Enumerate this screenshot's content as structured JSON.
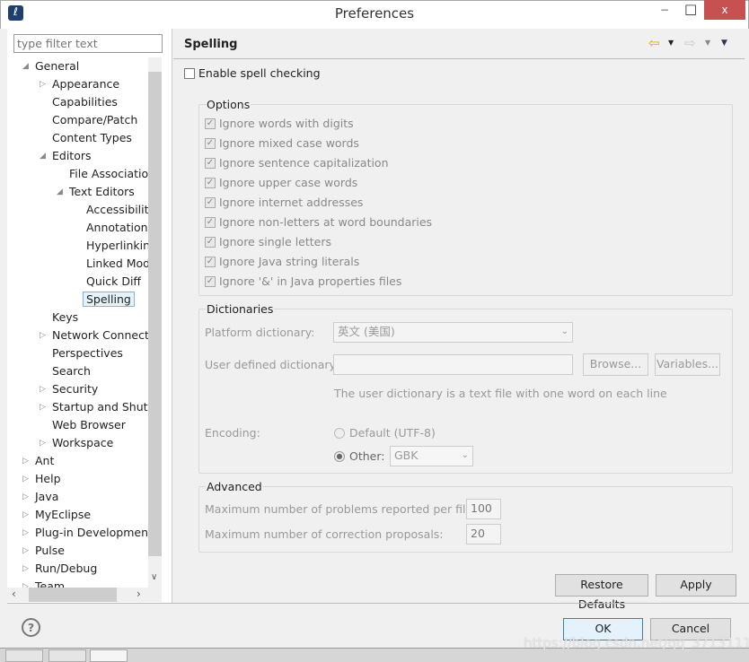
{
  "window": {
    "title": "Preferences",
    "close": "x",
    "minimize": "−",
    "maximize": "□"
  },
  "filter": {
    "placeholder": "type filter text"
  },
  "tree": [
    {
      "label": "General",
      "level": 0,
      "arrow": "open"
    },
    {
      "label": "Appearance",
      "level": 1,
      "arrow": "closed"
    },
    {
      "label": "Capabilities",
      "level": 1
    },
    {
      "label": "Compare/Patch",
      "level": 1
    },
    {
      "label": "Content Types",
      "level": 1
    },
    {
      "label": "Editors",
      "level": 1,
      "arrow": "open"
    },
    {
      "label": "File Associations",
      "level": 2
    },
    {
      "label": "Text Editors",
      "level": 2,
      "arrow": "open"
    },
    {
      "label": "Accessibility",
      "level": 3
    },
    {
      "label": "Annotations",
      "level": 3
    },
    {
      "label": "Hyperlinking",
      "level": 3
    },
    {
      "label": "Linked Mode",
      "level": 3
    },
    {
      "label": "Quick Diff",
      "level": 3
    },
    {
      "label": "Spelling",
      "level": 3,
      "selected": true
    },
    {
      "label": "Keys",
      "level": 1
    },
    {
      "label": "Network Connections",
      "level": 1,
      "arrow": "closed"
    },
    {
      "label": "Perspectives",
      "level": 1
    },
    {
      "label": "Search",
      "level": 1
    },
    {
      "label": "Security",
      "level": 1,
      "arrow": "closed"
    },
    {
      "label": "Startup and Shutdown",
      "level": 1,
      "arrow": "closed"
    },
    {
      "label": "Web Browser",
      "level": 1
    },
    {
      "label": "Workspace",
      "level": 1,
      "arrow": "closed"
    },
    {
      "label": "Ant",
      "level": 0,
      "arrow": "closed"
    },
    {
      "label": "Help",
      "level": 0,
      "arrow": "closed"
    },
    {
      "label": "Java",
      "level": 0,
      "arrow": "closed"
    },
    {
      "label": "MyEclipse",
      "level": 0,
      "arrow": "closed"
    },
    {
      "label": "Plug-in Development",
      "level": 0,
      "arrow": "closed"
    },
    {
      "label": "Pulse",
      "level": 0,
      "arrow": "closed"
    },
    {
      "label": "Run/Debug",
      "level": 0,
      "arrow": "closed"
    },
    {
      "label": "Team",
      "level": 0,
      "arrow": "closed"
    }
  ],
  "page": {
    "title": "Spelling",
    "enable_label": "Enable spell checking",
    "options_title": "Options",
    "options": [
      "Ignore words with digits",
      "Ignore mixed case words",
      "Ignore sentence capitalization",
      "Ignore upper case words",
      "Ignore internet addresses",
      "Ignore non-letters at word boundaries",
      "Ignore single letters",
      "Ignore Java string literals",
      "Ignore '&' in Java properties files"
    ],
    "dict_title": "Dictionaries",
    "platform_label": "Platform dictionary:",
    "platform_value": "英文 (美国)",
    "user_label": "User defined dictionary:",
    "user_value": "",
    "browse": "Browse...",
    "variables": "Variables...",
    "user_hint": "The user dictionary is a text file with one word on each line",
    "encoding_label": "Encoding:",
    "enc_default": "Default (UTF-8)",
    "enc_other": "Other:",
    "enc_value": "GBK",
    "adv_title": "Advanced",
    "max_problems_label": "Maximum number of problems reported per file:",
    "max_problems": "100",
    "max_corr_label": "Maximum number of correction proposals:",
    "max_corr": "20",
    "restore": "Restore Defaults",
    "apply": "Apply"
  },
  "footer": {
    "ok": "OK",
    "cancel": "Cancel"
  },
  "watermark": "https://blog.csdn.net/qq_37131111"
}
